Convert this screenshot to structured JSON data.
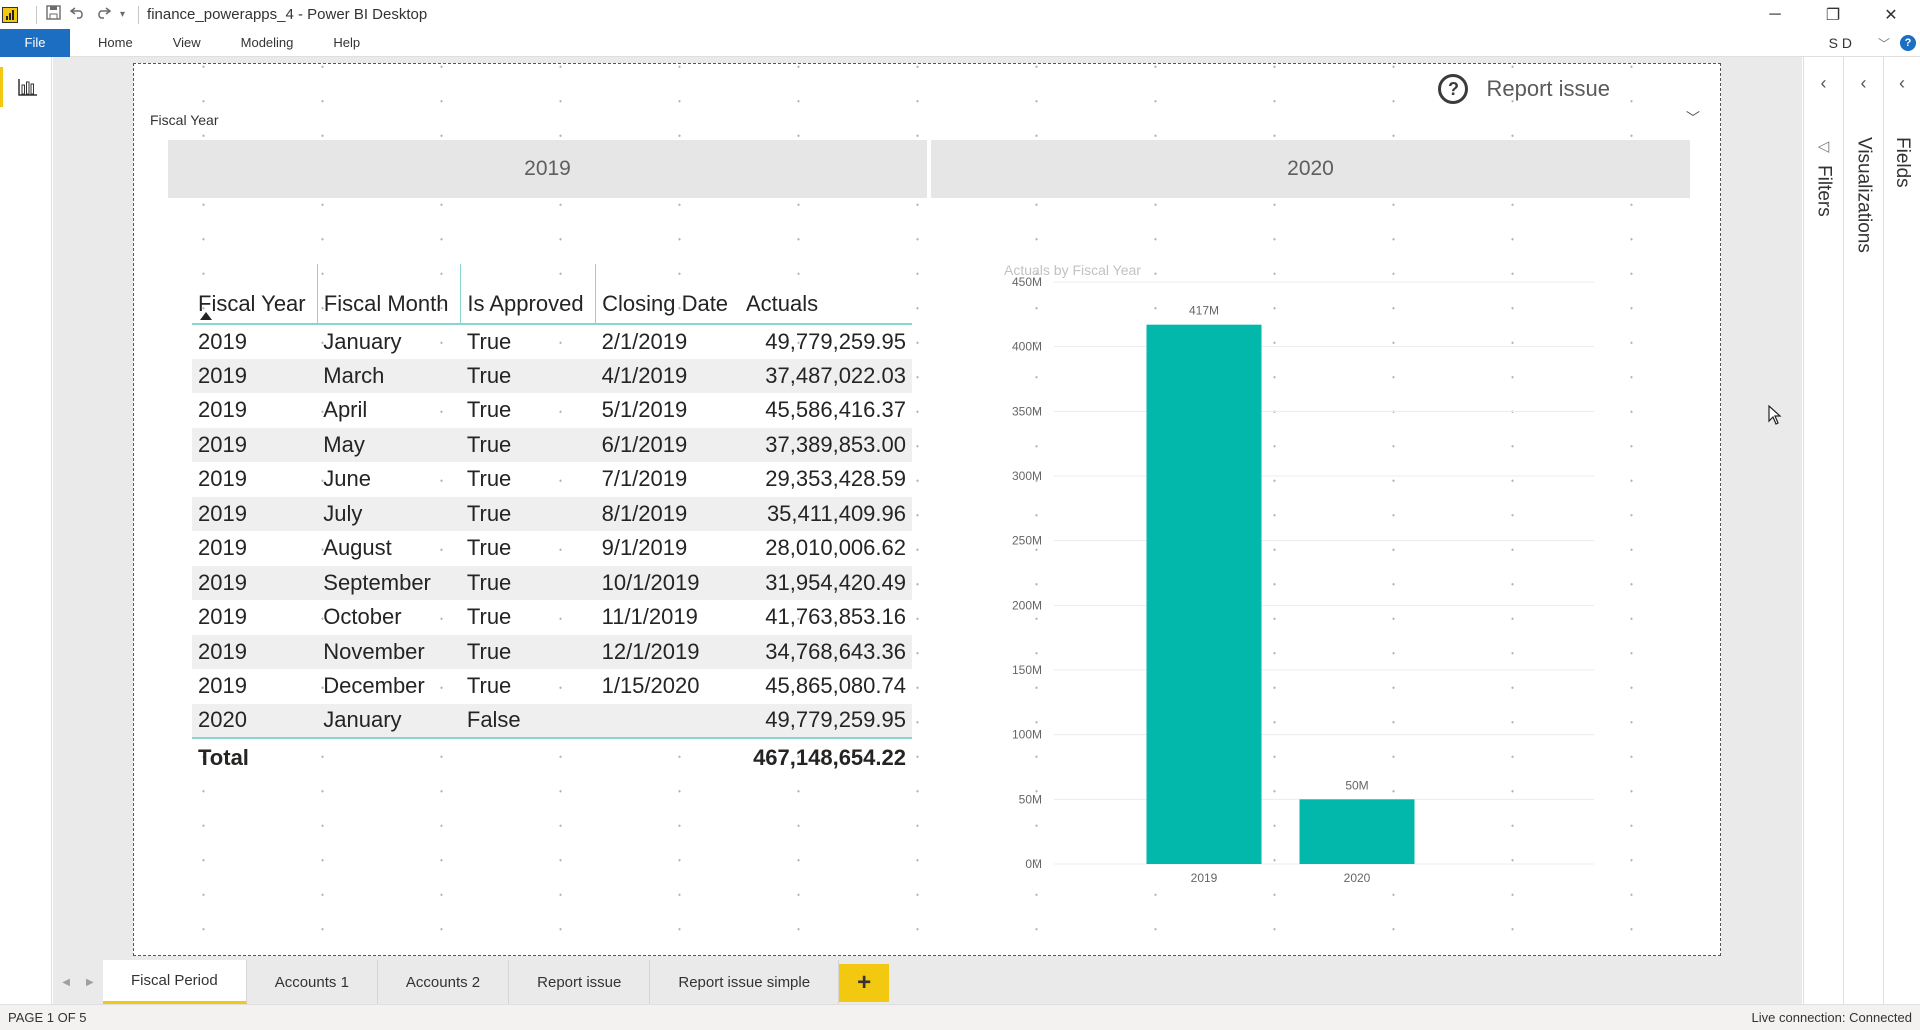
{
  "window": {
    "title": "finance_powerapps_4 - Power BI Desktop",
    "controls": {
      "minimize": "─",
      "restore": "❐",
      "close": "✕"
    }
  },
  "quick_access": {
    "save_icon": "save-icon",
    "undo_icon": "undo-icon",
    "redo_icon": "redo-icon"
  },
  "ribbon": {
    "file": "File",
    "tabs": [
      "Home",
      "View",
      "Modeling",
      "Help"
    ],
    "user_initials": "S D",
    "help": "?"
  },
  "report_issue": {
    "icon": "?",
    "label": "Report issue"
  },
  "slicer": {
    "title": "Fiscal Year",
    "options": [
      "2019",
      "2020"
    ]
  },
  "table": {
    "columns": [
      "Fiscal Year",
      "Fiscal Month",
      "Is Approved",
      "Closing Date",
      "Actuals"
    ],
    "rows": [
      [
        "2019",
        "January",
        "True",
        "2/1/2019",
        "49,779,259.95"
      ],
      [
        "2019",
        "March",
        "True",
        "4/1/2019",
        "37,487,022.03"
      ],
      [
        "2019",
        "April",
        "True",
        "5/1/2019",
        "45,586,416.37"
      ],
      [
        "2019",
        "May",
        "True",
        "6/1/2019",
        "37,389,853.00"
      ],
      [
        "2019",
        "June",
        "True",
        "7/1/2019",
        "29,353,428.59"
      ],
      [
        "2019",
        "July",
        "True",
        "8/1/2019",
        "35,411,409.96"
      ],
      [
        "2019",
        "August",
        "True",
        "9/1/2019",
        "28,010,006.62"
      ],
      [
        "2019",
        "September",
        "True",
        "10/1/2019",
        "31,954,420.49"
      ],
      [
        "2019",
        "October",
        "True",
        "11/1/2019",
        "41,763,853.16"
      ],
      [
        "2019",
        "November",
        "True",
        "12/1/2019",
        "34,768,643.36"
      ],
      [
        "2019",
        "December",
        "True",
        "1/15/2020",
        "45,865,080.74"
      ],
      [
        "2020",
        "January",
        "False",
        "",
        "49,779,259.95"
      ]
    ],
    "total_label": "Total",
    "total_value": "467,148,654.22"
  },
  "chart_data": {
    "type": "bar",
    "title": "Actuals by Fiscal Year",
    "categories": [
      "2019",
      "2020"
    ],
    "values": [
      417,
      50
    ],
    "data_labels": [
      "417M",
      "50M"
    ],
    "y_ticks": [
      "0M",
      "50M",
      "100M",
      "150M",
      "200M",
      "250M",
      "300M",
      "350M",
      "400M",
      "450M"
    ],
    "ylim": [
      0,
      450
    ],
    "grid": true,
    "bar_color": "#01b8aa"
  },
  "panes": {
    "filters": "Filters",
    "visualizations": "Visualizations",
    "fields": "Fields"
  },
  "page_tabs": {
    "tabs": [
      "Fiscal Period",
      "Accounts 1",
      "Accounts 2",
      "Report issue",
      "Report issue simple"
    ],
    "active": 0,
    "add": "+"
  },
  "status": {
    "page": "PAGE 1 OF 5",
    "connection": "Live connection: Connected"
  },
  "colors": {
    "accent": "#f2c811",
    "file_tab": "#1b6ec2",
    "table_line": "#89d6d1"
  }
}
